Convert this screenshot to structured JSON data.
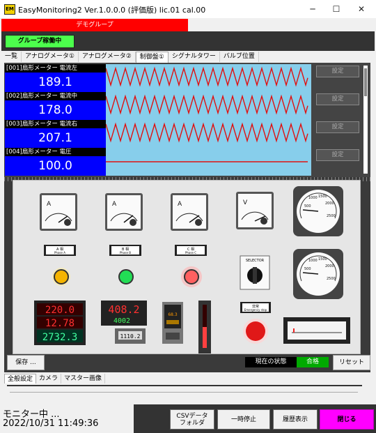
{
  "window": {
    "title": "EasyMonitoring2 Ver.1.0.0.0 (評価版)  lic.01 cal.00",
    "app_icon": "EM"
  },
  "group": {
    "tab_label": "デモグループ",
    "status": "グループ稼働中"
  },
  "tabs": [
    "一覧",
    "アナログメータ①",
    "アナログメータ②",
    "制御盤①",
    "シグナルタワー",
    "バルブ位置"
  ],
  "active_tab_index": 3,
  "meters": [
    {
      "label": "[001]扇形メーター 電流左",
      "value": "189.1"
    },
    {
      "label": "[002]扇形メーター 電流中",
      "value": "178.0"
    },
    {
      "label": "[003]扇形メーター 電流右",
      "value": "207.1"
    },
    {
      "label": "[004]扇形メーター 電圧",
      "value": "100.0"
    }
  ],
  "setting_label": "設定",
  "panel": {
    "labels": [
      {
        "main": "A 相",
        "sub": "Phase A"
      },
      {
        "main": "B 相",
        "sub": "Phase B"
      },
      {
        "main": "C 相",
        "sub": "Phase C"
      }
    ],
    "emergency": {
      "main": "非常",
      "sub": "Emergency stop"
    },
    "selector": "SELECTOR",
    "displays": {
      "d1": "220.0",
      "d2": "12.78",
      "d3": "2732.3",
      "d4": "408.2",
      "d5": "4002",
      "d6": "1110.2",
      "d7": "68.3"
    },
    "gauge_scale": [
      "500",
      "1000",
      "1500",
      "2000",
      "2500"
    ],
    "meter_letters": [
      "A",
      "A",
      "A",
      "V"
    ]
  },
  "controls": {
    "save": "保存 ...",
    "state_label": "現在の状態",
    "state_value": "合格",
    "reset": "リセット"
  },
  "lower_tabs": [
    "全般設定",
    "カメラ",
    "マスター画像"
  ],
  "status": {
    "monitoring": "モニター中 ...",
    "datetime": "2022/10/31 11:49:36"
  },
  "buttons": {
    "csv": "CSVデータ\nフォルダ",
    "pause": "一時停止",
    "history": "履歴表示",
    "close": "閉じる"
  },
  "colors": {
    "group_tab": "#ff0000",
    "status_green": "#4cff4c",
    "value_bg": "#0000ff",
    "chart_bg": "#87ceeb",
    "wave": "#e01010",
    "ok_green": "#00aa00",
    "close_magenta": "#ff00ff"
  }
}
